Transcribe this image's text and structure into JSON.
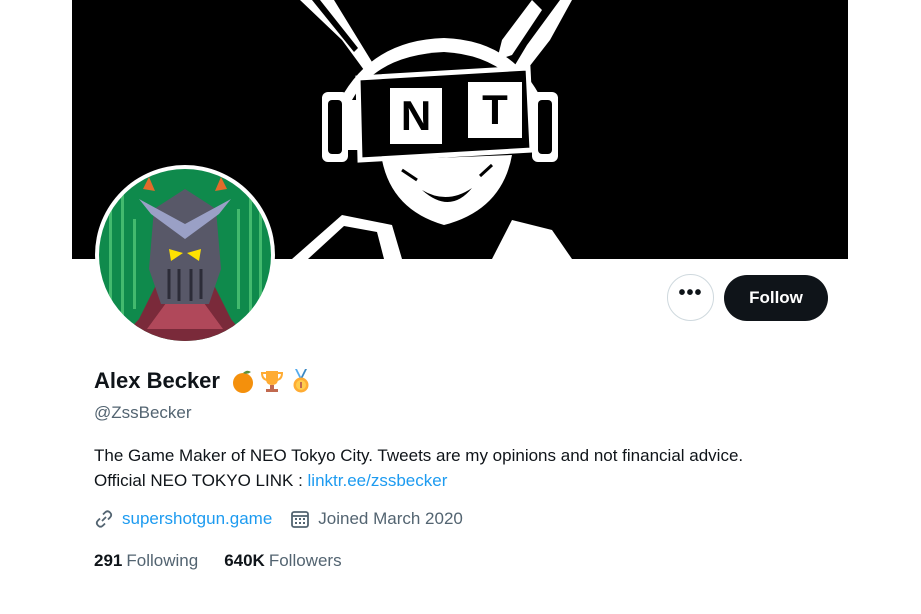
{
  "profile": {
    "display_name": "Alex Becker",
    "handle": "@ZssBecker",
    "badges": [
      "orange-emoji",
      "trophy-emoji",
      "medal-emoji"
    ],
    "bio_text": "The Game Maker of NEO Tokyo City. Tweets are my opinions and not financial advice. Official NEO TOKYO LINK : ",
    "bio_link": "linktr.ee/zssbecker",
    "website": "supershotgun.game",
    "joined": "Joined March 2020"
  },
  "actions": {
    "more_label": "•••",
    "follow_label": "Follow"
  },
  "stats": {
    "following_count": "291",
    "following_label": "Following",
    "followers_count": "640K",
    "followers_label": "Followers"
  },
  "banner": {
    "helmet_letters": [
      "N",
      "T"
    ]
  },
  "colors": {
    "accent": "#1d9bf0",
    "text": "#0f1419",
    "muted": "#536471"
  }
}
